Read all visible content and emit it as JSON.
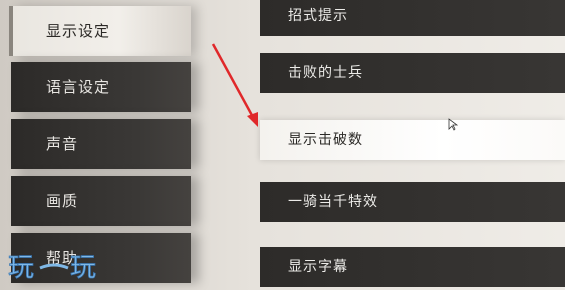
{
  "menu": {
    "items": [
      {
        "label": "显示设定",
        "selected": true
      },
      {
        "label": "语言设定",
        "selected": false
      },
      {
        "label": "声音",
        "selected": false
      },
      {
        "label": "画质",
        "selected": false
      },
      {
        "label": "帮助",
        "selected": false
      }
    ]
  },
  "options": {
    "items": [
      {
        "label": "招式提示",
        "highlighted": false
      },
      {
        "label": "击败的士兵",
        "highlighted": false
      },
      {
        "label": "显示击破数",
        "highlighted": true
      },
      {
        "label": "一骑当千特效",
        "highlighted": false
      },
      {
        "label": "显示字幕",
        "highlighted": false
      }
    ]
  },
  "watermark": {
    "text": "玩 玩"
  },
  "colors": {
    "arrow": "#e0282a",
    "panel_dark": "#2d2b29",
    "panel_light": "#f4f2ee"
  }
}
